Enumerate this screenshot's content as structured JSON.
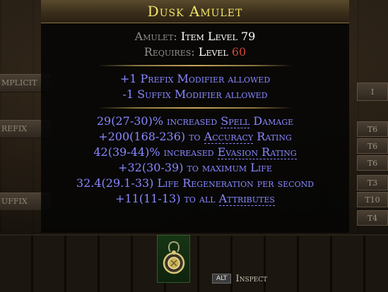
{
  "item": {
    "name": "Dusk Amulet",
    "base_label": "Amulet:",
    "level_label": "Item Level",
    "item_level": "79",
    "requires_label": "Requires:",
    "requires_level_label": "Level",
    "requires_level": "60"
  },
  "crafting_notes": [
    "+1 Prefix Modifier allowed",
    "-1 Suffix Modifier allowed"
  ],
  "mods": {
    "m1": {
      "pre": "29(27-30)% increased ",
      "kw": "Spell",
      "post": " Damage"
    },
    "m2": {
      "pre": "+200(168-236) to ",
      "kw": "Accuracy",
      "post": " Rating"
    },
    "m3": {
      "pre": "42(39-44)% increased ",
      "kw": "Evasion Rating",
      "post": ""
    },
    "m4": {
      "text": "+32(30-39) to maximum Life"
    },
    "m5": {
      "text": "32.4(29.1-33) Life Regeneration per second"
    },
    "m6": {
      "pre": "+11(11-13) to all ",
      "kw": "Attributes",
      "post": ""
    }
  },
  "side_labels": {
    "implicit": "MPLICIT",
    "prefix": "REFIX",
    "suffix": "UFFIX"
  },
  "tiers": {
    "implicit": "I",
    "t1": "T6",
    "t2": "T6",
    "t3": "T6",
    "t4": "T3",
    "t5": "T10",
    "t6": "T4"
  },
  "inspect": {
    "key": "ALT",
    "label": "Inspect"
  },
  "colors": {
    "unique_name": "#f4e56b",
    "magic_mod": "#8888ff",
    "requirement_unmet": "#d0453a",
    "label_grey": "#8f8f8f"
  }
}
